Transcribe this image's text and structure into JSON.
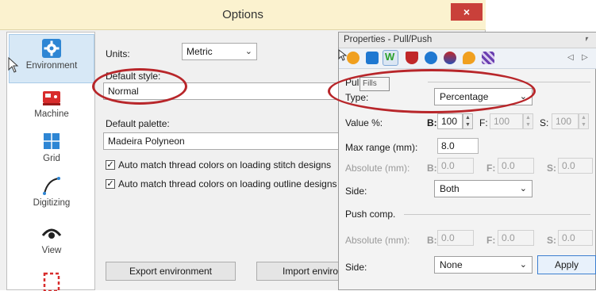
{
  "options_window": {
    "title": "Options",
    "close_label": "×",
    "sidebar": [
      {
        "label": "Environment",
        "icon": "gear-icon"
      },
      {
        "label": "Machine",
        "icon": "sewing-machine-icon"
      },
      {
        "label": "Grid",
        "icon": "grid-icon"
      },
      {
        "label": "Digitizing",
        "icon": "curve-icon"
      },
      {
        "label": "View",
        "icon": "eye-icon"
      }
    ],
    "units_label": "Units:",
    "units_value": "Metric",
    "default_style_label": "Default style:",
    "default_style_value": "Normal",
    "default_palette_label": "Default palette:",
    "default_palette_value": "Madeira Polyneon",
    "auto_match_stitch_label": "Auto match thread colors on loading stitch designs",
    "auto_match_outline_label": "Auto match thread colors on loading outline designs",
    "export_button": "Export environment",
    "import_button": "Import environ"
  },
  "properties": {
    "title": "Properties - Pull/Push",
    "tooltip": "Fills",
    "section_pull": "Pull",
    "type_label": "Type:",
    "type_value": "Percentage",
    "value_label": "Value %:",
    "b_label": "B:",
    "f_label": "F:",
    "s_label": "S:",
    "value_b": "100",
    "value_f": "100",
    "value_s": "100",
    "max_range_label": "Max range (mm):",
    "max_range_value": "8.0",
    "absolute_label": "Absolute (mm):",
    "abs_b": "0.0",
    "abs_f": "0.0",
    "abs_s": "0.0",
    "side_label": "Side:",
    "side_value": "Both",
    "section_push": "Push comp.",
    "push_abs_b": "0.0",
    "push_abs_f": "0.0",
    "push_abs_s": "0.0",
    "push_side_value": "None",
    "apply_button": "Apply",
    "nav_prev": "◁",
    "nav_next": "▷"
  }
}
